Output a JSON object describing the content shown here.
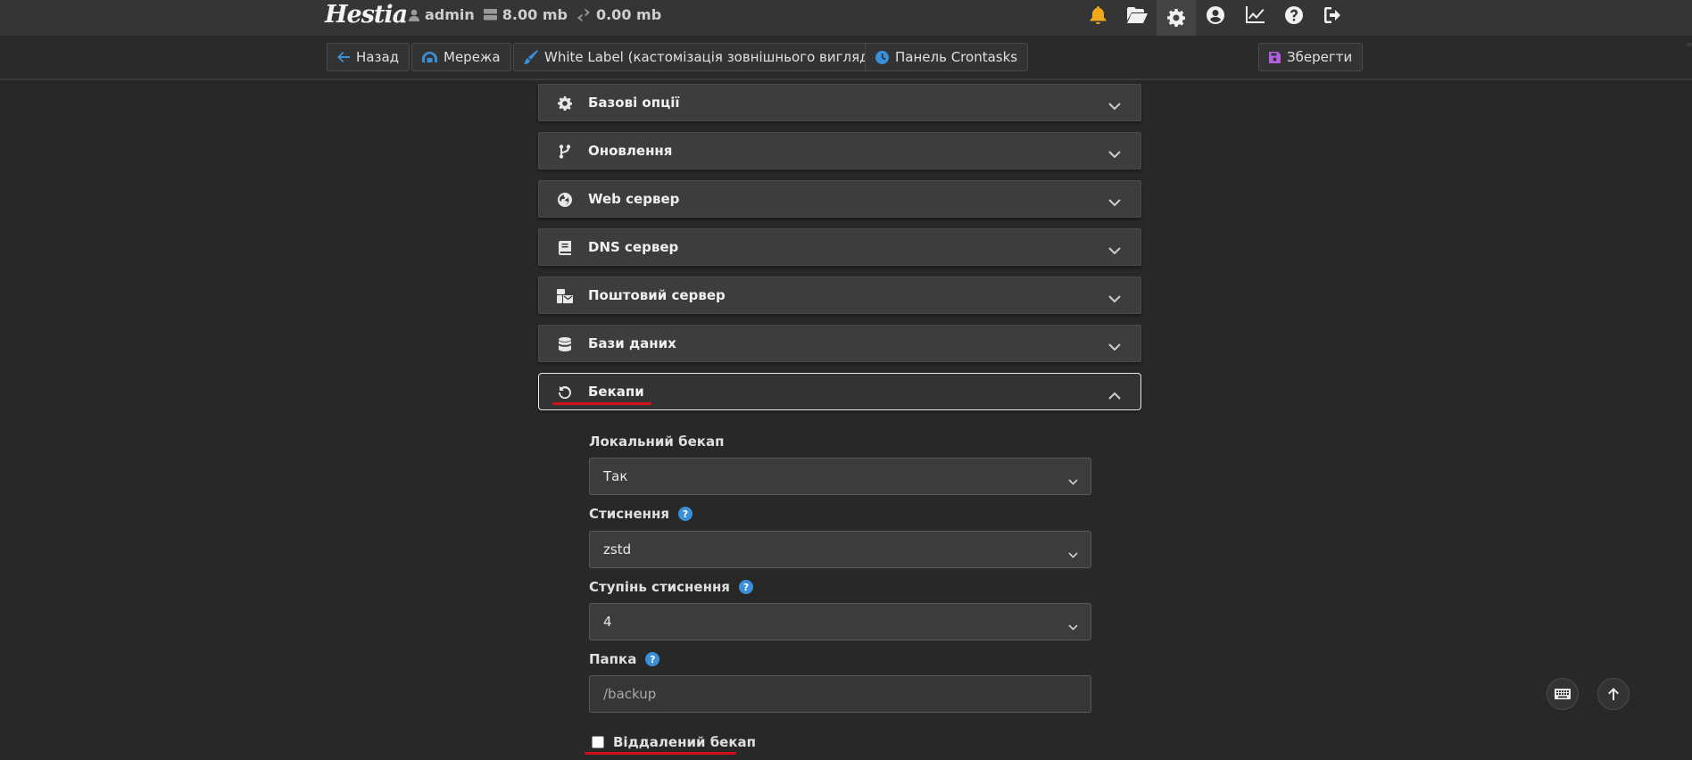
{
  "topbar": {
    "logo": "Hestia",
    "user": "admin",
    "disk": "8.00 mb",
    "bandwidth": "0.00 mb",
    "icons": [
      "bell-icon",
      "folder-open-icon",
      "gear-icon",
      "user-circle-icon",
      "chart-line-icon",
      "question-icon",
      "logout-icon"
    ]
  },
  "toolbar": {
    "back": "Назад",
    "network": "Мережа",
    "white_label": "White Label (кастомізація зовнішнього вигляду)",
    "crontasks": "Панель Crontasks",
    "save": "Зберегти"
  },
  "sections": [
    {
      "label": "Базові опції",
      "icon": "gear-icon"
    },
    {
      "label": "Оновлення",
      "icon": "code-branch-icon"
    },
    {
      "label": "Web сервер",
      "icon": "globe-icon"
    },
    {
      "label": "DNS сервер",
      "icon": "book-icon"
    },
    {
      "label": "Поштовий сервер",
      "icon": "mail-bulk-icon"
    },
    {
      "label": "Бази даних",
      "icon": "database-icon"
    },
    {
      "label": "Бекапи",
      "icon": "rotate-left-icon",
      "open": true
    }
  ],
  "backup": {
    "local_label": "Локальний бекап",
    "local_value": "Так",
    "compression_label": "Стиснення",
    "compression_value": "zstd",
    "level_label": "Ступінь стиснення",
    "level_value": "4",
    "folder_label": "Папка",
    "folder_placeholder": "/backup",
    "remote_label": "Віддалений бекап",
    "remote_checked": false,
    "help_glyph": "?"
  },
  "colors": {
    "background": "#282828",
    "accent_blue": "#3a8fd9",
    "bell": "#f0a91b",
    "highlight_red": "#d0101a"
  }
}
